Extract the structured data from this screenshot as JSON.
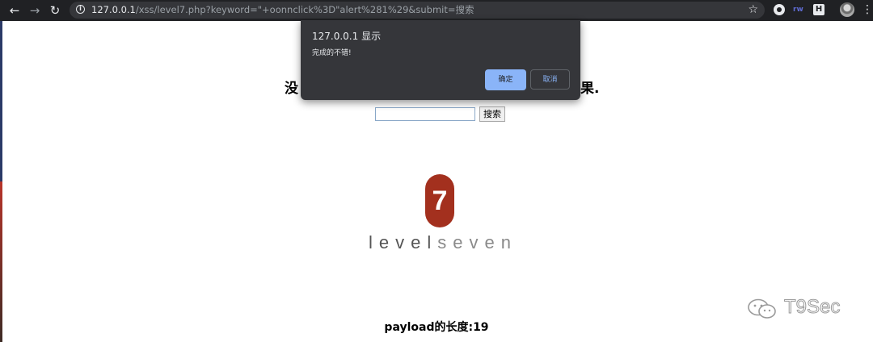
{
  "browser": {
    "url_host": "127.0.0.1",
    "url_path": "/xss/level7.php?keyword=\"+oonnclick%3D\"alert%281%29&submit=搜索",
    "icons": [
      "back-arrow-icon",
      "forward-arrow-icon",
      "reload-icon",
      "info-icon",
      "bookmark-star-icon",
      "menu-kebab-icon"
    ],
    "extension_3_label": "H",
    "extension_2_label": "rw"
  },
  "page": {
    "welcome_left": "没",
    "welcome_right": "果.",
    "search_input_value": "",
    "search_button_label": "搜索",
    "logo_number": "7",
    "logo_word_1": "level",
    "logo_word_2": "seven",
    "payload_text": "payload的长度:19"
  },
  "dialog": {
    "title": "127.0.0.1 显示",
    "message": "完成的不错!",
    "ok_label": "确定",
    "cancel_label": "取消"
  },
  "watermark": {
    "text": "T9Sec"
  },
  "colors": {
    "chrome_dark": "#202124",
    "dialog_bg": "#35363a",
    "dialog_accent": "#8ab4f8",
    "logo_red": "#a3301e"
  }
}
